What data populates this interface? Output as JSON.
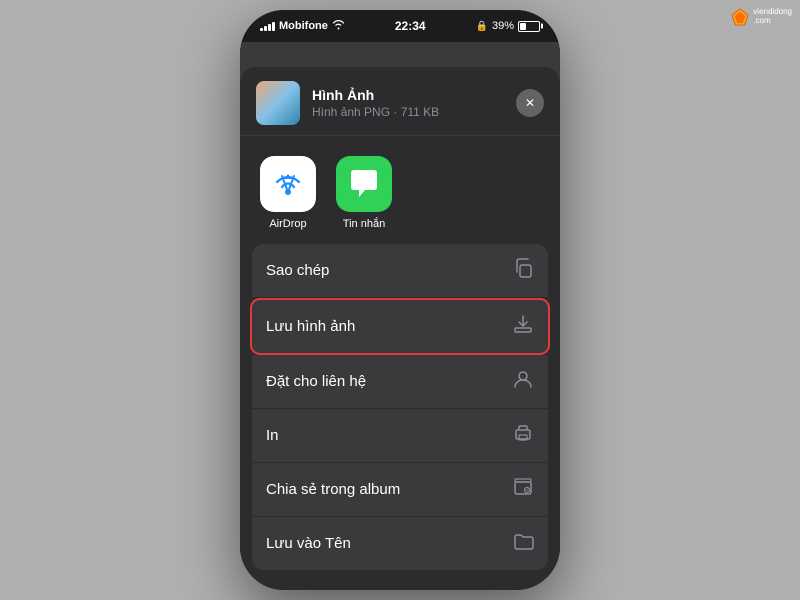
{
  "statusBar": {
    "carrier": "Mobifone",
    "time": "22:34",
    "battery": "39%"
  },
  "shareSheet": {
    "title": "Hình Ảnh",
    "subtitle": "Hình ảnh PNG · 711 KB",
    "closeLabel": "×"
  },
  "apps": [
    {
      "id": "airdrop",
      "label": "AirDrop"
    },
    {
      "id": "messages",
      "label": "Tin nhắn"
    }
  ],
  "menuItems": [
    {
      "id": "copy",
      "label": "Sao chép",
      "icon": "copy",
      "highlighted": false
    },
    {
      "id": "save-image",
      "label": "Lưu hình ảnh",
      "icon": "download",
      "highlighted": true
    },
    {
      "id": "assign-contact",
      "label": "Đặt cho liên hệ",
      "icon": "person",
      "highlighted": false
    },
    {
      "id": "print",
      "label": "In",
      "icon": "print",
      "highlighted": false
    },
    {
      "id": "share-album",
      "label": "Chia sẻ trong album",
      "icon": "album",
      "highlighted": false
    },
    {
      "id": "save-to",
      "label": "Lưu vào Tên",
      "icon": "folder",
      "highlighted": false
    }
  ],
  "watermark": {
    "site": "viendidong",
    "tld": ".com"
  }
}
